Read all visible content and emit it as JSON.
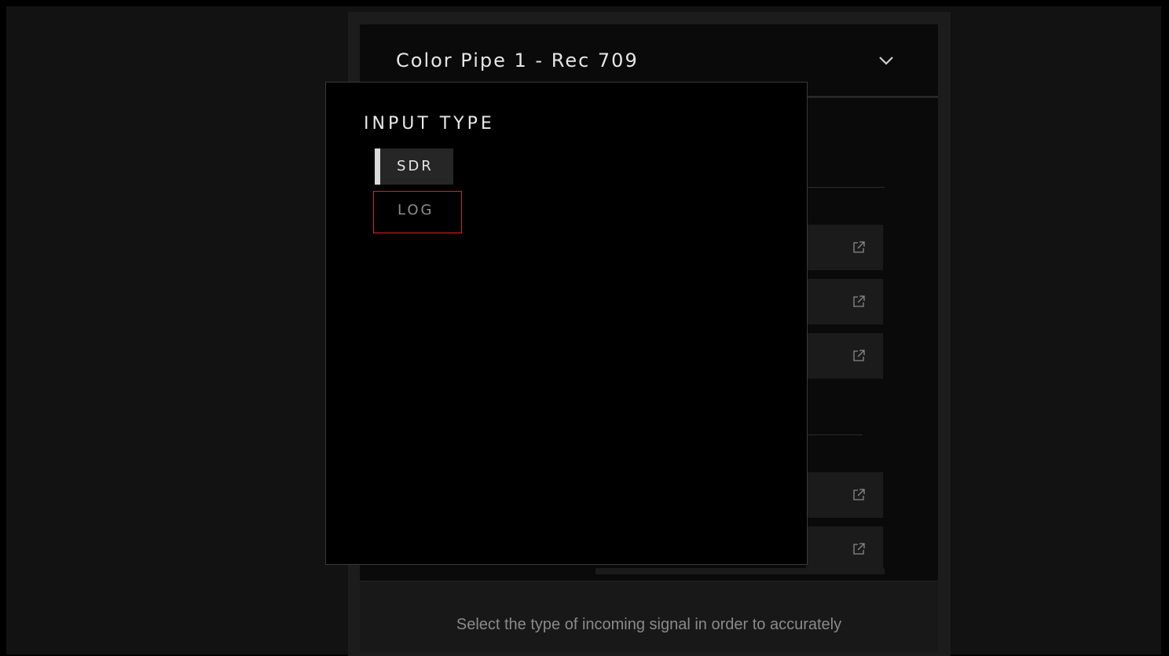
{
  "header": {
    "title": "Color Pipe 1 - Rec 709",
    "dropdown_icon": "chevron-down-icon"
  },
  "rows": [
    {
      "icon": "external-link-icon"
    },
    {
      "icon": "external-link-icon"
    },
    {
      "icon": "external-link-icon"
    },
    {
      "icon": "external-link-icon"
    },
    {
      "icon": "external-link-icon"
    }
  ],
  "footer": {
    "hint": "Select the type of incoming signal in order to accurately"
  },
  "popup": {
    "title": "INPUT TYPE",
    "options": [
      {
        "label": "SDR",
        "selected": true
      },
      {
        "label": "LOG",
        "selected": false,
        "highlighted": true
      }
    ]
  },
  "colors": {
    "selected_bar": "#d9d9d9",
    "highlight_border": "#e02020",
    "background": "#121212"
  }
}
